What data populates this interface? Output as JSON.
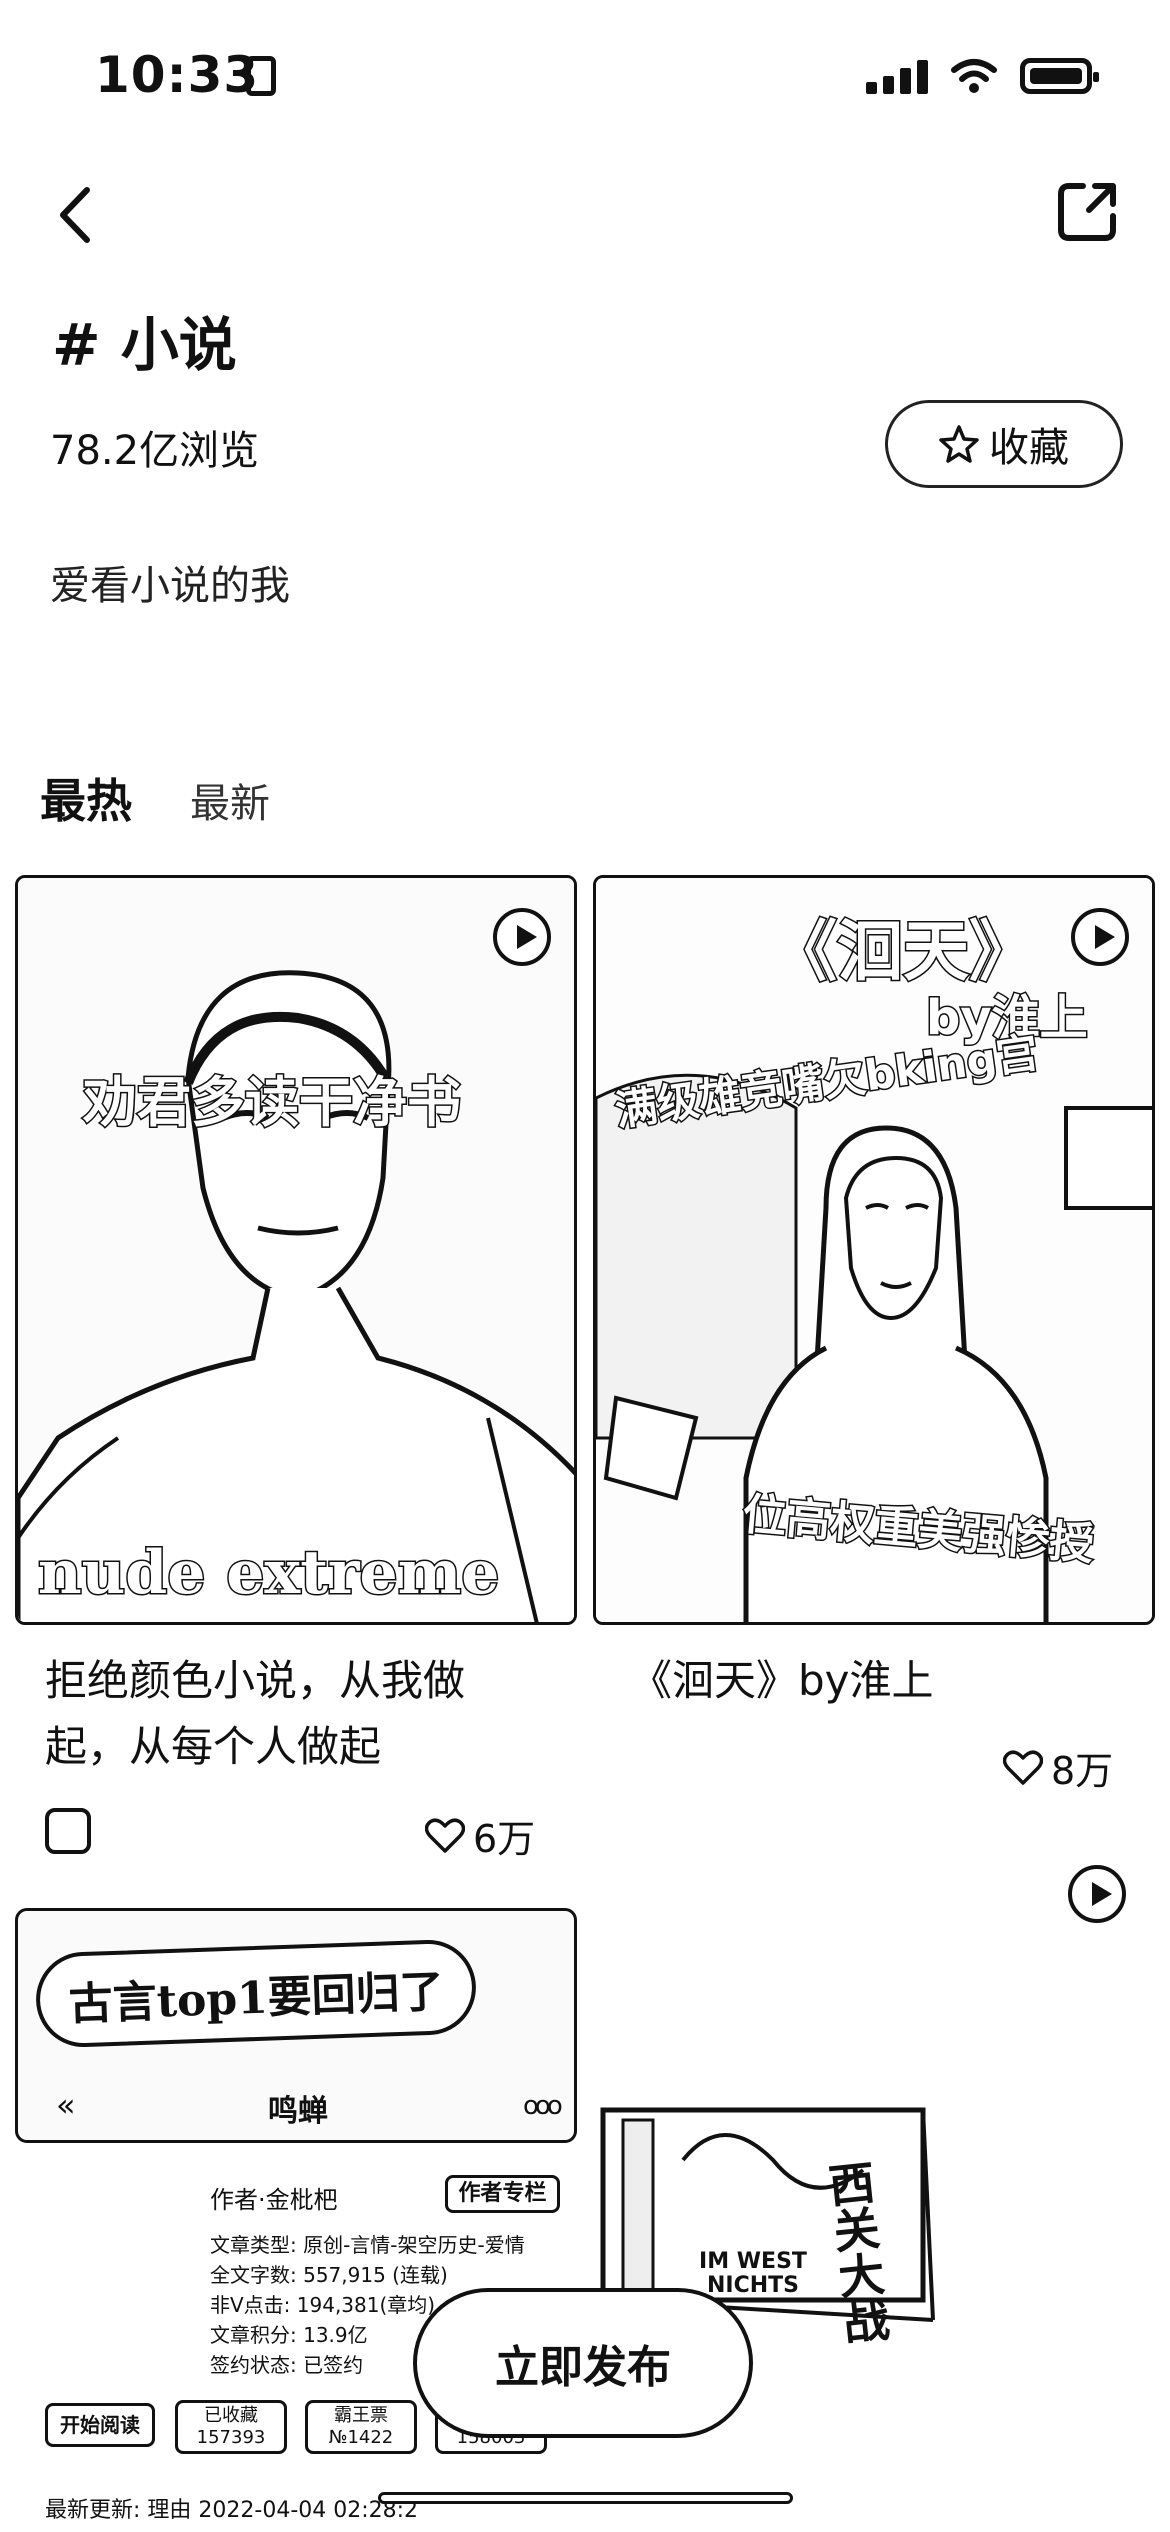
{
  "status": {
    "time": "10:33"
  },
  "topic": {
    "title": "# 小说",
    "views": "78.2亿浏览",
    "favorite_label": "收藏",
    "description": "爱看小说的我"
  },
  "tabs": [
    {
      "label": "最热",
      "active": true
    },
    {
      "label": "最新",
      "active": false
    }
  ],
  "posts": [
    {
      "image_caption": "劝君多读干净书",
      "shirt_text": "nude extreme",
      "title": "拒绝颜色小说，从我做起，从每个人做起",
      "likes": "6万"
    },
    {
      "image_title": "《洄天》",
      "image_author": "by淮上",
      "image_tag1": "满级雄竞嘴欠bking宫",
      "image_tag2": "位高权重美强惨授",
      "title": "《洄天》by淮上",
      "likes": "8万"
    },
    {
      "banner_text": "古言top1要回归了",
      "book_name": "鸣蝉",
      "author": "作者·金枇杷",
      "author_badge": "作者专栏",
      "meta": [
        "文章类型: 原创-言情-架空历史-爱情",
        "全文字数: 557,915 (连载)",
        "非V点击: 194,381(章均)",
        "文章积分: 13.9亿",
        "签约状态: 已签约"
      ],
      "buttons": [
        {
          "label": "开始阅读"
        },
        {
          "label": "已收藏",
          "count": "157393"
        },
        {
          "label": "霸王票",
          "count": "№1422"
        },
        {
          "label": "",
          "count": "158003"
        }
      ],
      "update_line": "最新更新:   理由  2022-04-04 02:28:2"
    },
    {
      "book_cover_title": "西关大战",
      "book_cover_sub": "IM WEST NICHTS"
    }
  ],
  "publish_label": "立即发布"
}
